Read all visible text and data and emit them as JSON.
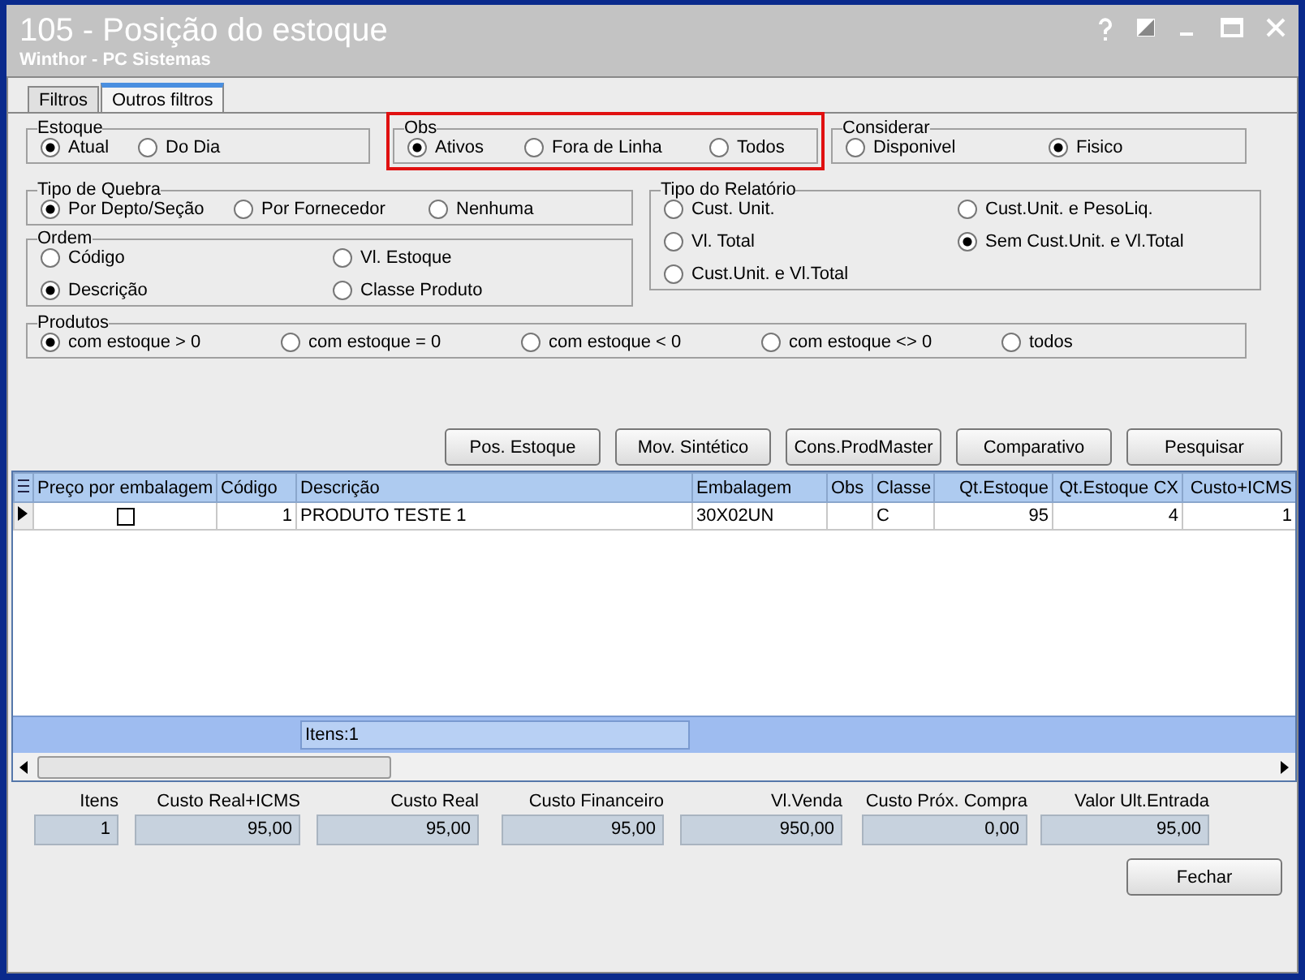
{
  "window": {
    "title": "105 - Posição do estoque",
    "subtitle": "Winthor - PC Sistemas"
  },
  "tabs": [
    {
      "label": "Filtros",
      "selected": false
    },
    {
      "label": "Outros filtros",
      "selected": true
    }
  ],
  "groups_row1": [
    {
      "title": "Estoque",
      "highlighted": false,
      "options": [
        {
          "label": "Atual",
          "selected": true
        },
        {
          "label": "Do Dia",
          "selected": false
        }
      ]
    },
    {
      "title": "Obs",
      "highlighted": true,
      "options": [
        {
          "label": "Ativos",
          "selected": true
        },
        {
          "label": "Fora de Linha",
          "selected": false
        },
        {
          "label": "Todos",
          "selected": false
        }
      ]
    },
    {
      "title": "Considerar",
      "highlighted": false,
      "options": [
        {
          "label": "Disponivel",
          "selected": false
        },
        {
          "label": "Fisico",
          "selected": true
        }
      ]
    }
  ],
  "tipo_quebra": {
    "title": "Tipo de Quebra",
    "options": [
      {
        "label": "Por Depto/Seção",
        "selected": true
      },
      {
        "label": "Por Fornecedor",
        "selected": false
      },
      {
        "label": "Nenhuma",
        "selected": false
      }
    ]
  },
  "ordem": {
    "title": "Ordem",
    "options": [
      {
        "label": "Código",
        "selected": false
      },
      {
        "label": "Vl. Estoque",
        "selected": false
      },
      {
        "label": "Descrição",
        "selected": true
      },
      {
        "label": "Classe Produto",
        "selected": false
      }
    ]
  },
  "tipo_relatorio": {
    "title": "Tipo do Relatório",
    "options": [
      {
        "label": "Cust. Unit.",
        "selected": false
      },
      {
        "label": "Cust.Unit. e PesoLiq.",
        "selected": false
      },
      {
        "label": "Vl. Total",
        "selected": false
      },
      {
        "label": "Sem Cust.Unit. e Vl.Total",
        "selected": true
      },
      {
        "label": "Cust.Unit. e Vl.Total",
        "selected": false
      }
    ]
  },
  "produtos": {
    "title": "Produtos",
    "options": [
      {
        "label": "com estoque > 0",
        "selected": true
      },
      {
        "label": "com estoque = 0",
        "selected": false
      },
      {
        "label": "com estoque < 0",
        "selected": false
      },
      {
        "label": "com estoque <> 0",
        "selected": false
      },
      {
        "label": "todos",
        "selected": false
      }
    ]
  },
  "action_buttons": [
    "Pos. Estoque",
    "Mov. Sintético",
    "Cons.ProdMaster",
    "Comparativo",
    "Pesquisar"
  ],
  "table": {
    "columns": [
      "Preço por embalagem",
      "Código",
      "Descrição",
      "Embalagem",
      "Obs",
      "Classe",
      "Qt.Estoque",
      "Qt.Estoque CX",
      "Custo+ICMS"
    ],
    "rows": [
      {
        "preco_por_embalagem": false,
        "codigo": "1",
        "descricao": "PRODUTO TESTE 1",
        "embalagem": "30X02UN",
        "obs": "",
        "classe": "C",
        "qt_estoque": "95",
        "qt_estoque_cx": "4",
        "custo_icms": "1"
      }
    ],
    "footer": "Itens:1"
  },
  "totals": [
    {
      "label": "Itens",
      "value": "1"
    },
    {
      "label": "Custo Real+ICMS",
      "value": "95,00"
    },
    {
      "label": "Custo Real",
      "value": "95,00"
    },
    {
      "label": "Custo Financeiro",
      "value": "95,00"
    },
    {
      "label": "Vl.Venda",
      "value": "950,00"
    },
    {
      "label": "Custo Próx. Compra",
      "value": "0,00"
    },
    {
      "label": "Valor Ult.Entrada",
      "value": "95,00"
    }
  ],
  "close_button": "Fechar"
}
